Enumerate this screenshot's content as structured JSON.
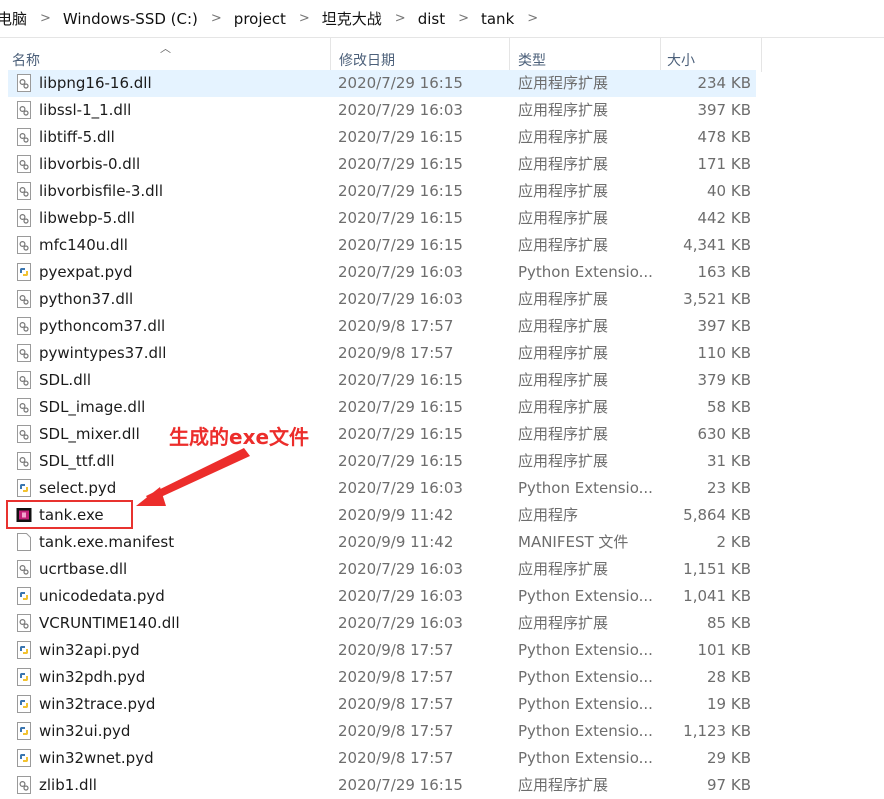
{
  "breadcrumb": {
    "items": [
      "电脑",
      "Windows-SSD (C:)",
      "project",
      "坦克大战",
      "dist",
      "tank"
    ],
    "separator": ">"
  },
  "columns": {
    "name": "名称",
    "date": "修改日期",
    "type": "类型",
    "size": "大小",
    "sort_indicator": "^"
  },
  "files": [
    {
      "name": "libpng16-16.dll",
      "date": "2020/7/29 16:15",
      "type": "应用程序扩展",
      "size": "234 KB",
      "icon": "dll-file-icon"
    },
    {
      "name": "libssl-1_1.dll",
      "date": "2020/7/29 16:03",
      "type": "应用程序扩展",
      "size": "397 KB",
      "icon": "dll-file-icon"
    },
    {
      "name": "libtiff-5.dll",
      "date": "2020/7/29 16:15",
      "type": "应用程序扩展",
      "size": "478 KB",
      "icon": "dll-file-icon"
    },
    {
      "name": "libvorbis-0.dll",
      "date": "2020/7/29 16:15",
      "type": "应用程序扩展",
      "size": "171 KB",
      "icon": "dll-file-icon"
    },
    {
      "name": "libvorbisfile-3.dll",
      "date": "2020/7/29 16:15",
      "type": "应用程序扩展",
      "size": "40 KB",
      "icon": "dll-file-icon"
    },
    {
      "name": "libwebp-5.dll",
      "date": "2020/7/29 16:15",
      "type": "应用程序扩展",
      "size": "442 KB",
      "icon": "dll-file-icon"
    },
    {
      "name": "mfc140u.dll",
      "date": "2020/7/29 16:15",
      "type": "应用程序扩展",
      "size": "4,341 KB",
      "icon": "dll-file-icon"
    },
    {
      "name": "pyexpat.pyd",
      "date": "2020/7/29 16:03",
      "type": "Python Extensio...",
      "size": "163 KB",
      "icon": "python-file-icon"
    },
    {
      "name": "python37.dll",
      "date": "2020/7/29 16:03",
      "type": "应用程序扩展",
      "size": "3,521 KB",
      "icon": "dll-file-icon"
    },
    {
      "name": "pythoncom37.dll",
      "date": "2020/9/8 17:57",
      "type": "应用程序扩展",
      "size": "397 KB",
      "icon": "dll-file-icon"
    },
    {
      "name": "pywintypes37.dll",
      "date": "2020/9/8 17:57",
      "type": "应用程序扩展",
      "size": "110 KB",
      "icon": "dll-file-icon"
    },
    {
      "name": "SDL.dll",
      "date": "2020/7/29 16:15",
      "type": "应用程序扩展",
      "size": "379 KB",
      "icon": "dll-file-icon"
    },
    {
      "name": "SDL_image.dll",
      "date": "2020/7/29 16:15",
      "type": "应用程序扩展",
      "size": "58 KB",
      "icon": "dll-file-icon"
    },
    {
      "name": "SDL_mixer.dll",
      "date": "2020/7/29 16:15",
      "type": "应用程序扩展",
      "size": "630 KB",
      "icon": "dll-file-icon"
    },
    {
      "name": "SDL_ttf.dll",
      "date": "2020/7/29 16:15",
      "type": "应用程序扩展",
      "size": "31 KB",
      "icon": "dll-file-icon"
    },
    {
      "name": "select.pyd",
      "date": "2020/7/29 16:03",
      "type": "Python Extensio...",
      "size": "23 KB",
      "icon": "python-file-icon"
    },
    {
      "name": "tank.exe",
      "date": "2020/9/9 11:42",
      "type": "应用程序",
      "size": "5,864 KB",
      "icon": "exe-file-icon"
    },
    {
      "name": "tank.exe.manifest",
      "date": "2020/9/9 11:42",
      "type": "MANIFEST 文件",
      "size": "2 KB",
      "icon": "blank-file-icon"
    },
    {
      "name": "ucrtbase.dll",
      "date": "2020/7/29 16:03",
      "type": "应用程序扩展",
      "size": "1,151 KB",
      "icon": "dll-file-icon"
    },
    {
      "name": "unicodedata.pyd",
      "date": "2020/7/29 16:03",
      "type": "Python Extensio...",
      "size": "1,041 KB",
      "icon": "python-file-icon"
    },
    {
      "name": "VCRUNTIME140.dll",
      "date": "2020/7/29 16:03",
      "type": "应用程序扩展",
      "size": "85 KB",
      "icon": "dll-file-icon"
    },
    {
      "name": "win32api.pyd",
      "date": "2020/9/8 17:57",
      "type": "Python Extensio...",
      "size": "101 KB",
      "icon": "python-file-icon"
    },
    {
      "name": "win32pdh.pyd",
      "date": "2020/9/8 17:57",
      "type": "Python Extensio...",
      "size": "28 KB",
      "icon": "python-file-icon"
    },
    {
      "name": "win32trace.pyd",
      "date": "2020/9/8 17:57",
      "type": "Python Extensio...",
      "size": "19 KB",
      "icon": "python-file-icon"
    },
    {
      "name": "win32ui.pyd",
      "date": "2020/9/8 17:57",
      "type": "Python Extensio...",
      "size": "1,123 KB",
      "icon": "python-file-icon"
    },
    {
      "name": "win32wnet.pyd",
      "date": "2020/9/8 17:57",
      "type": "Python Extensio...",
      "size": "29 KB",
      "icon": "python-file-icon"
    },
    {
      "name": "zlib1.dll",
      "date": "2020/7/29 16:15",
      "type": "应用程序扩展",
      "size": "97 KB",
      "icon": "dll-file-icon"
    }
  ],
  "annotation": {
    "text": "生成的exe文件",
    "color": "#ec2d2b"
  },
  "colors": {
    "selected_row": "#e5f3ff",
    "header_text": "#4c607a"
  }
}
